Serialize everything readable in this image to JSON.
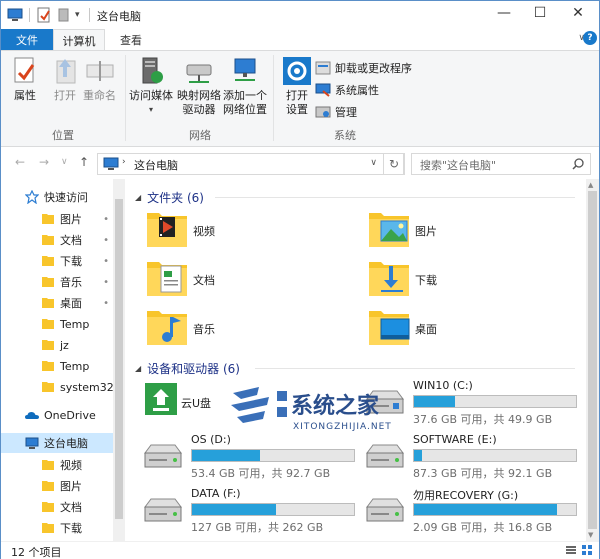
{
  "window": {
    "title": "这台电脑",
    "controls": {
      "minimize": "—",
      "maximize": "☐",
      "close": "✕"
    }
  },
  "ribbon_tabs": {
    "file": "文件",
    "computer": "计算机",
    "view": "查看",
    "help": "?"
  },
  "ribbon": {
    "location": {
      "label": "位置",
      "properties": "属性",
      "open": "打开",
      "rename": "重命名"
    },
    "network": {
      "label": "网络",
      "media_line1": "访问媒体",
      "map_line1": "映射网络",
      "map_line2": "驱动器",
      "add_line1": "添加一个",
      "add_line2": "网络位置"
    },
    "system": {
      "label": "系统",
      "settings_line1": "打开",
      "settings_line2": "设置",
      "uninstall": "卸载或更改程序",
      "sys_props": "系统属性",
      "manage": "管理"
    }
  },
  "address": {
    "path": "这台电脑",
    "search_placeholder": "搜索\"这台电脑\""
  },
  "nav": {
    "quick_access": "快速访问",
    "items": [
      {
        "label": "图片",
        "pinned": true
      },
      {
        "label": "文档",
        "pinned": true
      },
      {
        "label": "下载",
        "pinned": true
      },
      {
        "label": "音乐",
        "pinned": true
      },
      {
        "label": "桌面",
        "pinned": true
      },
      {
        "label": "Temp",
        "pinned": false
      },
      {
        "label": "jz",
        "pinned": false
      },
      {
        "label": "Temp",
        "pinned": false
      },
      {
        "label": "system32",
        "pinned": false
      }
    ],
    "onedrive": "OneDrive",
    "this_pc": "这台电脑",
    "pc_items": [
      "视频",
      "图片",
      "文档",
      "下载"
    ],
    "pin_glyph": "📌"
  },
  "content": {
    "folders_header": "文件夹 (6)",
    "folders": [
      "视频",
      "图片",
      "文档",
      "下载",
      "音乐",
      "桌面"
    ],
    "devices_header": "设备和驱动器 (6)",
    "drives": [
      {
        "name": "云U盘",
        "info": "",
        "fill": 0
      },
      {
        "name": "WIN10 (C:)",
        "info": "37.6 GB 可用，共 49.9 GB",
        "fill": 0.25
      },
      {
        "name": "OS (D:)",
        "info": "53.4 GB 可用，共 92.7 GB",
        "fill": 0.42
      },
      {
        "name": "SOFTWARE (E:)",
        "info": "87.3 GB 可用，共 92.1 GB",
        "fill": 0.05
      },
      {
        "name": "DATA (F:)",
        "info": "127 GB 可用，共 262 GB",
        "fill": 0.52
      },
      {
        "name": "勿用RECOVERY (G:)",
        "info": "2.09 GB 可用，共 16.8 GB",
        "fill": 0.88
      }
    ]
  },
  "watermark": {
    "text_cn": "系统之家",
    "text_en": "XITONGZHIJIA.NET"
  },
  "status": {
    "count": "12 个项目"
  },
  "colors": {
    "accent": "#1979ca",
    "folder": "#f8c52b",
    "drive_bar": "#26a0da",
    "selected": "#cce8ff"
  }
}
